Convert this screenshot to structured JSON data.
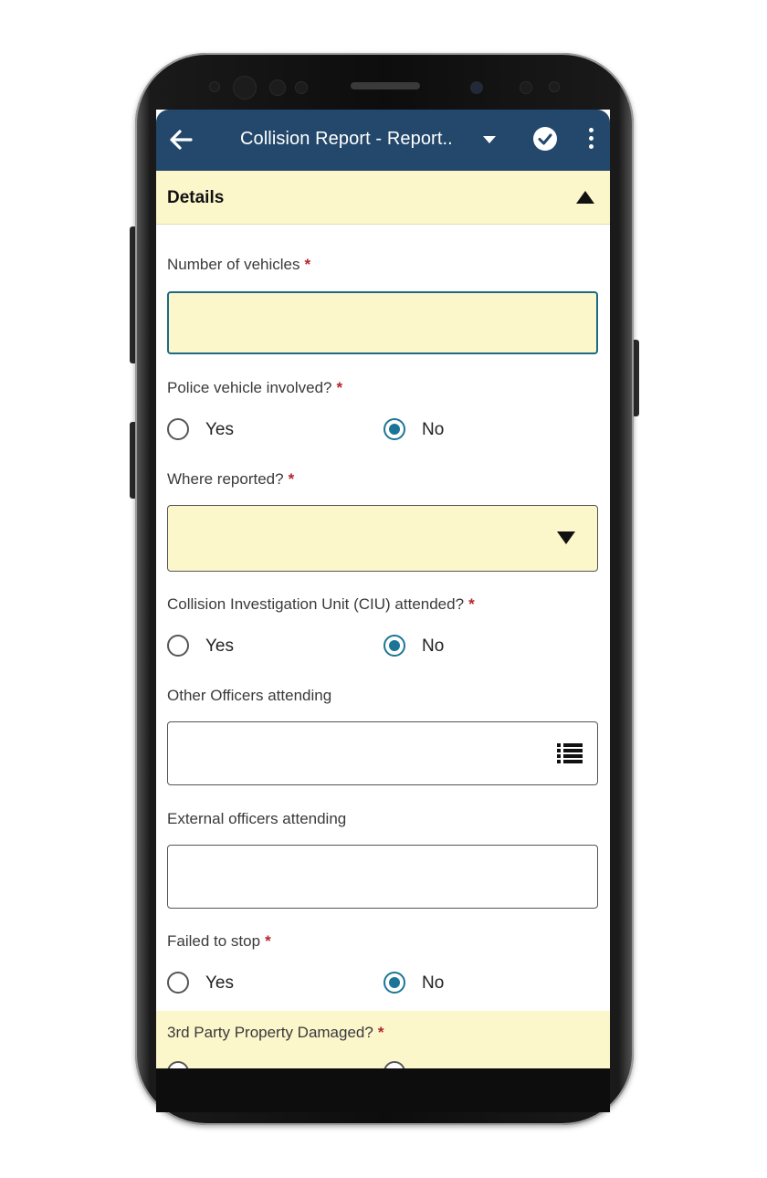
{
  "appbar": {
    "title": "Collision Report  - Report..",
    "icons": {
      "back": "arrow-left-icon",
      "dropdown": "chevron-down-icon",
      "confirm": "check-circle-icon",
      "menu": "more-vert-icon"
    }
  },
  "section": {
    "title": "Details"
  },
  "required_marker": "*",
  "fields": {
    "num_vehicles": {
      "label": "Number of vehicles",
      "value": ""
    },
    "police_vehicle": {
      "label": "Police vehicle involved?",
      "yes": "Yes",
      "no": "No",
      "selected": "No"
    },
    "where_reported": {
      "label": "Where reported?",
      "value": ""
    },
    "ciu": {
      "label": "Collision Investigation Unit (CIU) attended?",
      "yes": "Yes",
      "no": "No",
      "selected": "No"
    },
    "other_officers": {
      "label": "Other Officers attending",
      "value": ""
    },
    "external_officers": {
      "label": "External officers attending",
      "value": ""
    },
    "failed_to_stop": {
      "label": "Failed to stop",
      "yes": "Yes",
      "no": "No",
      "selected": "No"
    },
    "third_party": {
      "label": "3rd Party Property Damaged?"
    }
  },
  "colors": {
    "appbar": "#23486b",
    "highlight": "#fcf6cb",
    "accent": "#1c7596",
    "required": "#b3262e"
  }
}
